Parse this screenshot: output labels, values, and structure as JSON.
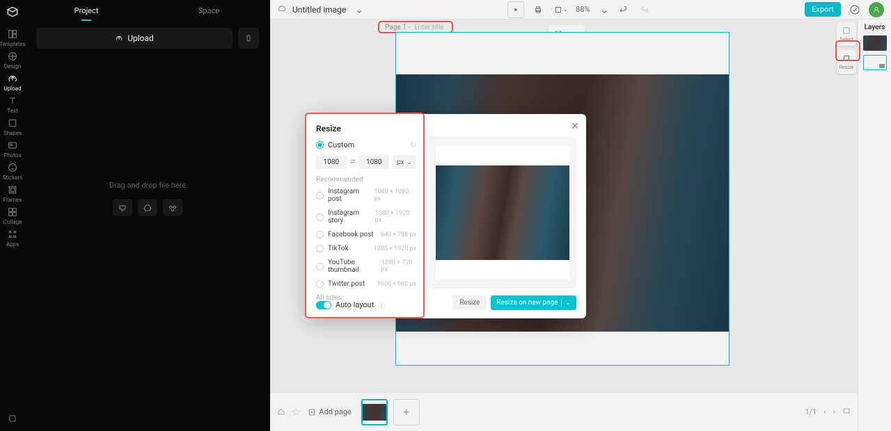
{
  "sidebar": {
    "items": [
      {
        "label": "Templates"
      },
      {
        "label": "Design"
      },
      {
        "label": "Upload"
      },
      {
        "label": "Text"
      },
      {
        "label": "Shapes"
      },
      {
        "label": "Photos"
      },
      {
        "label": "Stickers"
      },
      {
        "label": "Frames"
      },
      {
        "label": "Collage"
      },
      {
        "label": "Apps"
      }
    ]
  },
  "left_panel": {
    "tab_project": "Project",
    "tab_space": "Space",
    "upload_label": "Upload",
    "drop_text": "Drag and drop file here"
  },
  "topbar": {
    "title": "Untitled image",
    "zoom": "88%",
    "export": "Export"
  },
  "canvas": {
    "page_label": "Page 1 -",
    "page_add": "Enter title"
  },
  "right_tools": {
    "select": "Select",
    "resize": "Resize"
  },
  "layers": {
    "title": "Layers"
  },
  "bottombar": {
    "add_page": "Add page",
    "page_count": "1/1"
  },
  "modal": {
    "title": "Resize",
    "custom": "Custom",
    "width": "1080",
    "height": "1080",
    "unit": "px",
    "recommended": "Recommended",
    "presets": [
      {
        "name": "Instagram post",
        "dim": "1080 × 1080 px"
      },
      {
        "name": "Instagram story",
        "dim": "1080 × 1920 px"
      },
      {
        "name": "Facebook post",
        "dim": "940 × 788 px"
      },
      {
        "name": "TikTok",
        "dim": "1080 × 1920 px"
      },
      {
        "name": "YouTube thumbnail",
        "dim": "1280 × 720 px"
      },
      {
        "name": "Twitter post",
        "dim": "1600 × 900 px"
      }
    ],
    "all_sizes": "All sizes",
    "auto_layout": "Auto layout",
    "resize_btn": "Resize",
    "resize_new_btn": "Resize on new page"
  }
}
